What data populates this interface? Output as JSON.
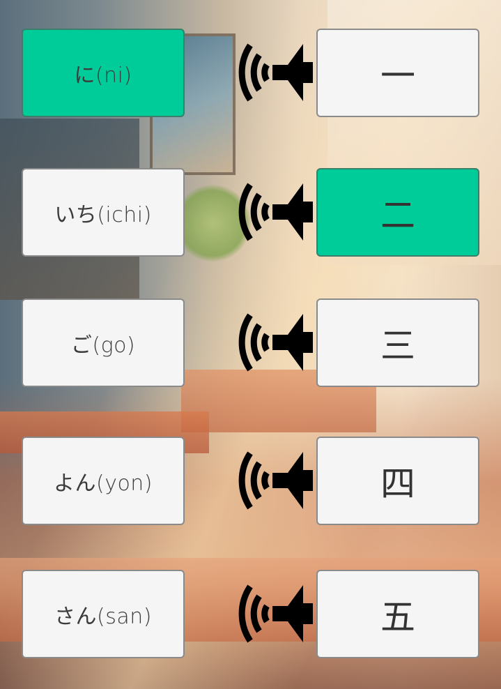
{
  "pairs": [
    {
      "reading": "に(ni)",
      "numeral": "一",
      "reading_selected": true,
      "numeral_selected": false
    },
    {
      "reading": "いち(ichi)",
      "numeral": "二",
      "reading_selected": false,
      "numeral_selected": true
    },
    {
      "reading": "ご(go)",
      "numeral": "三",
      "reading_selected": false,
      "numeral_selected": false
    },
    {
      "reading": "よん(yon)",
      "numeral": "四",
      "reading_selected": false,
      "numeral_selected": false
    },
    {
      "reading": "さん(san)",
      "numeral": "五",
      "reading_selected": false,
      "numeral_selected": false
    }
  ],
  "icons": {
    "audio": "speaker-icon"
  },
  "colors": {
    "card_background": "#f5f5f5",
    "card_selected": "#00cc99",
    "card_border": "#8a8a8a",
    "text": "#333333"
  }
}
